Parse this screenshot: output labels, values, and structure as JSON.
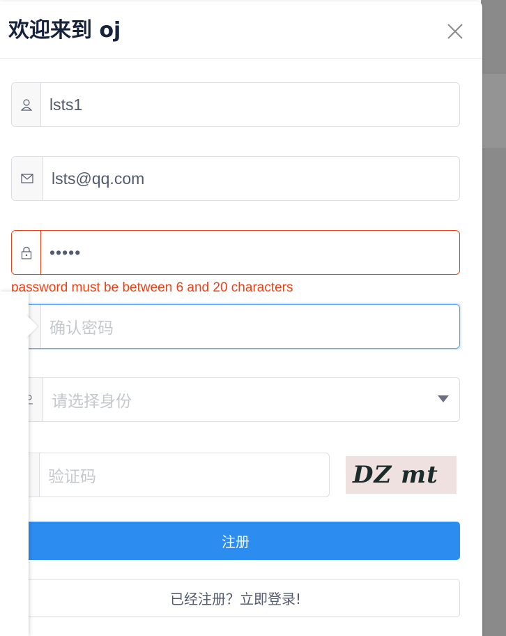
{
  "modal": {
    "title": "欢迎来到 oj",
    "close_icon": "close-icon"
  },
  "form": {
    "username": {
      "value": "lsts1",
      "icon": "user-icon"
    },
    "email": {
      "value": "lsts@qq.com",
      "icon": "mail-icon"
    },
    "password": {
      "value_masked": "•••••",
      "icon": "lock-icon",
      "error": "password must be between 6 and 20 characters"
    },
    "confirm_password": {
      "placeholder": "确认密码",
      "icon": "lock-icon"
    },
    "role": {
      "placeholder": "请选择身份",
      "icon": "people-icon",
      "arrow_icon": "caret-down-icon"
    },
    "captcha": {
      "placeholder": "验证码",
      "image_text": "DZ mt",
      "icon": "key-icon"
    }
  },
  "buttons": {
    "register": "注册",
    "login_link": "已经注册？立即登录!"
  },
  "colors": {
    "primary": "#2d8cf0",
    "error": "#ed4014",
    "focus": "#57a3f3",
    "captcha_bg": "#f0e1e1"
  }
}
